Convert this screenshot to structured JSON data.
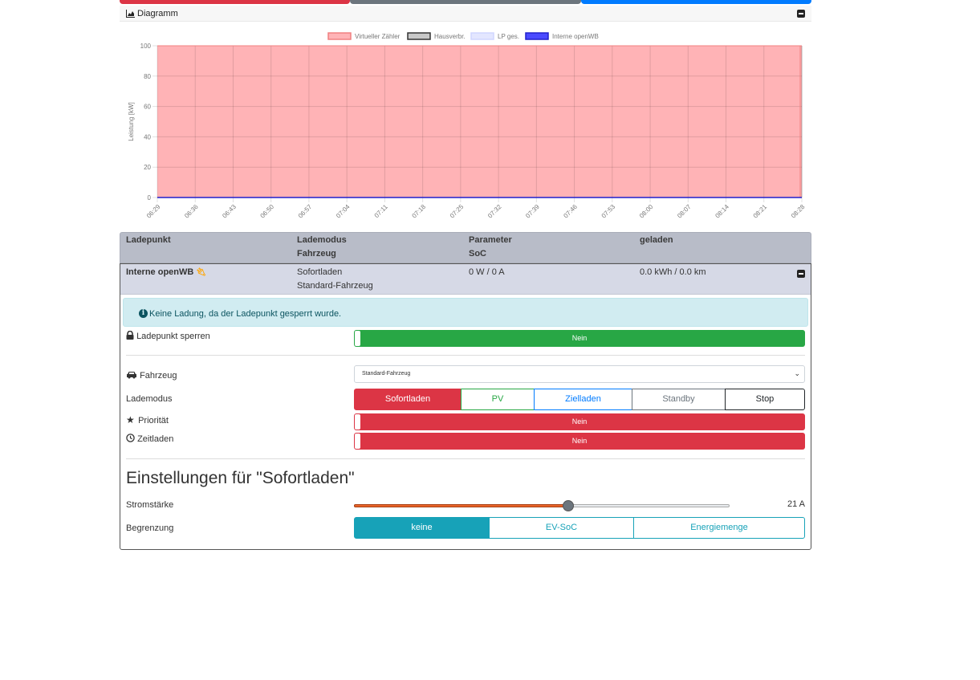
{
  "colors": {
    "red": "#dc3545",
    "gray": "#6c757d",
    "blue": "#007bff",
    "green": "#28a745",
    "info": "#17a2b8",
    "black": "#212529",
    "chart_fill": "#ffb3b6"
  },
  "chart_card": {
    "title": "Diagramm",
    "title_icon": "area-chart-icon",
    "collapse_icon": "minus-square-icon"
  },
  "chart_data": {
    "type": "area",
    "x": [
      "06:29",
      "06:36",
      "06:43",
      "06:50",
      "06:57",
      "07:04",
      "07:11",
      "07:18",
      "07:25",
      "07:32",
      "07:39",
      "07:46",
      "07:53",
      "08:00",
      "08:07",
      "08:14",
      "08:21",
      "08:28"
    ],
    "ylabel": "Leistung [kW]",
    "ylim": [
      0,
      100
    ],
    "yticks": [
      0,
      20,
      40,
      60,
      80,
      100
    ],
    "grid": true,
    "legend_position": "top-center",
    "series": [
      {
        "name": "Virtueller Zähler",
        "color": "#ffb3b6",
        "border": "#f08080",
        "values": [
          100,
          100,
          100,
          100,
          100,
          100,
          100,
          100,
          100,
          100,
          100,
          100,
          100,
          100,
          100,
          100,
          100,
          100
        ]
      },
      {
        "name": "Hausverbr.",
        "color": "#c8c8c8",
        "border": "#333333",
        "values": [
          0,
          0,
          0,
          0,
          0,
          0,
          0,
          0,
          0,
          0,
          0,
          0,
          0,
          0,
          0,
          0,
          0,
          0
        ]
      },
      {
        "name": "LP ges.",
        "color": "#e3e6ff",
        "border": "#d0d6ff",
        "values": [
          0,
          0,
          0,
          0,
          0,
          0,
          0,
          0,
          0,
          0,
          0,
          0,
          0,
          0,
          0,
          0,
          0,
          0
        ]
      },
      {
        "name": "Interne openWB",
        "color": "#4a4aff",
        "border": "#2020cc",
        "values": [
          0,
          0,
          0,
          0,
          0,
          0,
          0,
          0,
          0,
          0,
          0,
          0,
          0,
          0,
          0,
          0,
          0,
          0
        ]
      }
    ]
  },
  "lp_table": {
    "headers": {
      "col1": "Ladepunkt",
      "col2a": "Lademodus",
      "col2b": "Fahrzeug",
      "col3a": "Parameter",
      "col3b": "SoC",
      "col4": "geladen"
    },
    "row": {
      "name": "Interne openWB",
      "mode": "Sofortladen",
      "vehicle": "Standard-Fahrzeug",
      "parameter": "0 W / 0 A",
      "charged": "0.0 kWh / 0.0 km"
    }
  },
  "detail": {
    "info_text": "Keine Ladung, da der Ladepunkt gesperrt wurde.",
    "lock_label": "Ladepunkt sperren",
    "lock_value": "Nein",
    "vehicle_label": "Fahrzeug",
    "vehicle_selected": "Standard-Fahrzeug",
    "mode_label": "Lademodus",
    "modes": [
      "Sofortladen",
      "PV",
      "Zielladen",
      "Standby",
      "Stop"
    ],
    "priority_label": "Priorität",
    "priority_value": "Nein",
    "timed_label": "Zeitladen",
    "timed_value": "Nein",
    "settings_heading": "Einstellungen für \"Sofortladen\"",
    "current_label": "Stromstärke",
    "current_value": "21 A",
    "current_fraction": 0.57,
    "limit_label": "Begrenzung",
    "limits": [
      "keine",
      "EV-SoC",
      "Energiemenge"
    ]
  }
}
